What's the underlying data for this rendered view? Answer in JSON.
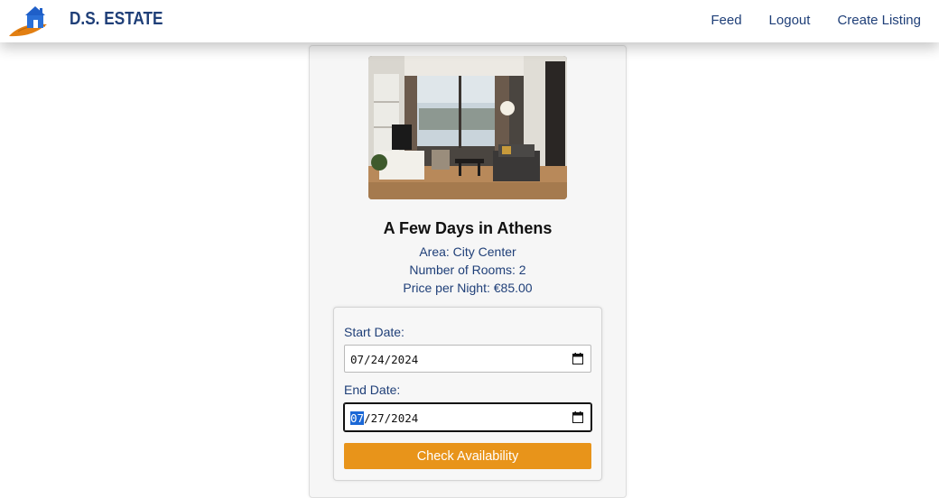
{
  "navbar": {
    "brand": "D.S. ESTATE",
    "logo_icon": "house-on-orange-swoosh-logo",
    "links": [
      "Feed",
      "Logout",
      "Create Listing"
    ]
  },
  "listing": {
    "photo_icon": "apartment-living-room-photo",
    "title": "A Few Days in Athens",
    "area": "Area: City Center",
    "rooms": "Number of Rooms: 2",
    "price": "Price per Night: €85.00"
  },
  "booking": {
    "start_label": "Start Date:",
    "start_value": "07/24/2024",
    "end_label": "End Date:",
    "end_value_selected": "07",
    "end_value_rest": "/27/2024",
    "calendar_icon": "calendar-icon",
    "button_label": "Check Availability"
  },
  "colors": {
    "primary_text": "#1f3f78",
    "accent": "#e8941a",
    "selection": "#1b68d6"
  }
}
